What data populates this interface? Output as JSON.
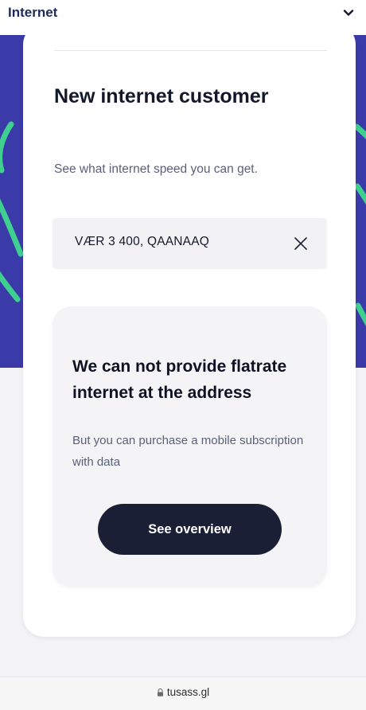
{
  "header": {
    "title": "Internet",
    "chevron_icon": "chevron-down-icon"
  },
  "form": {
    "heading": "New internet customer",
    "subtext": "See what internet speed you can get.",
    "address_value": "VÆR 3  400, QAANAAQ",
    "clear_icon": "close-icon"
  },
  "result": {
    "title": "We can not provide flatrate internet at the address",
    "description": "But you can purchase a mobile subscription with data",
    "button_label": "See overview"
  },
  "browser": {
    "url": "tusass.gl",
    "lock_icon": "lock-icon"
  },
  "colors": {
    "brand_purple": "#3b3aa9",
    "accent_green": "#3fcf8e",
    "button_dark": "#1b1f35",
    "nav_title": "#1f2a5c"
  }
}
